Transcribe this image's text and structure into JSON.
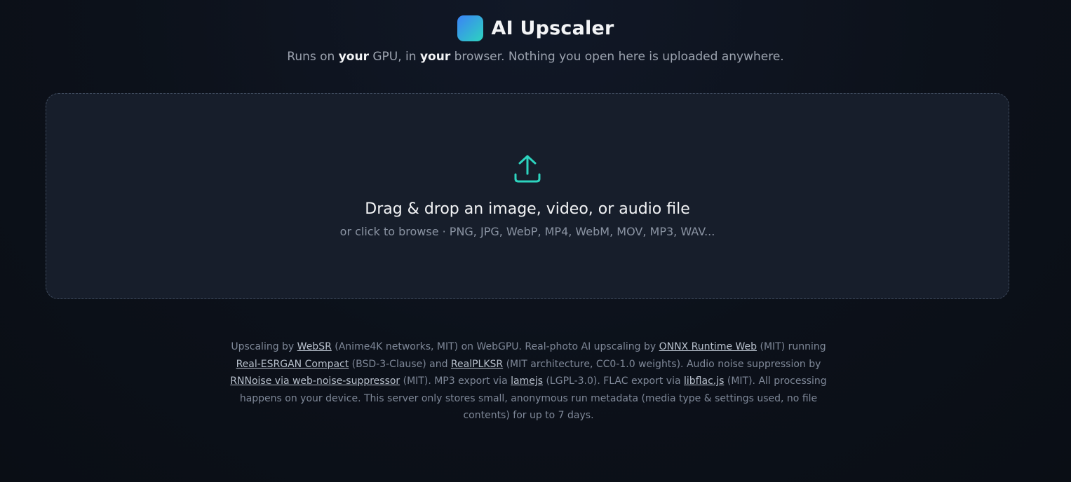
{
  "header": {
    "title": "AI Upscaler",
    "tagline": {
      "part1": "Runs on ",
      "em1": "your",
      "part2": " GPU, in ",
      "em2": "your",
      "part3": " browser. Nothing you open here is uploaded anywhere."
    }
  },
  "dropzone": {
    "icon": "upload-icon",
    "title": "Drag & drop an image, video, or audio file",
    "subtitle": "or click to browse · PNG, JPG, WebP, MP4, WebM, MOV, MP3, WAV..."
  },
  "footer": {
    "t1": "Upscaling by ",
    "link_websr": "WebSR",
    "t2": " (Anime4K networks, MIT) on WebGPU. Real-photo AI upscaling by ",
    "link_onnx": "ONNX Runtime Web",
    "t3": " (MIT) running ",
    "link_esrgan": "Real-ESRGAN Compact",
    "t4": " (BSD-3-Clause) and ",
    "link_plksr": "RealPLKSR",
    "t5": " (MIT architecture, CC0-1.0 weights). Audio noise suppression by ",
    "link_rnnoise": "RNNoise via web-noise-suppressor",
    "t6": " (MIT). MP3 export via ",
    "link_lamejs": "lamejs",
    "t7": " (LGPL-3.0). FLAC export via ",
    "link_libflac": "libflac.js",
    "t8": " (MIT). All processing happens on your device. This server only stores small, anonymous run metadata (media type & settings used, no file contents) for up to 7 days."
  },
  "colors": {
    "accent": "#2dd4bf",
    "logo_start": "#3b82f6",
    "logo_end": "#2dd4bf",
    "background": "#0c111a"
  }
}
